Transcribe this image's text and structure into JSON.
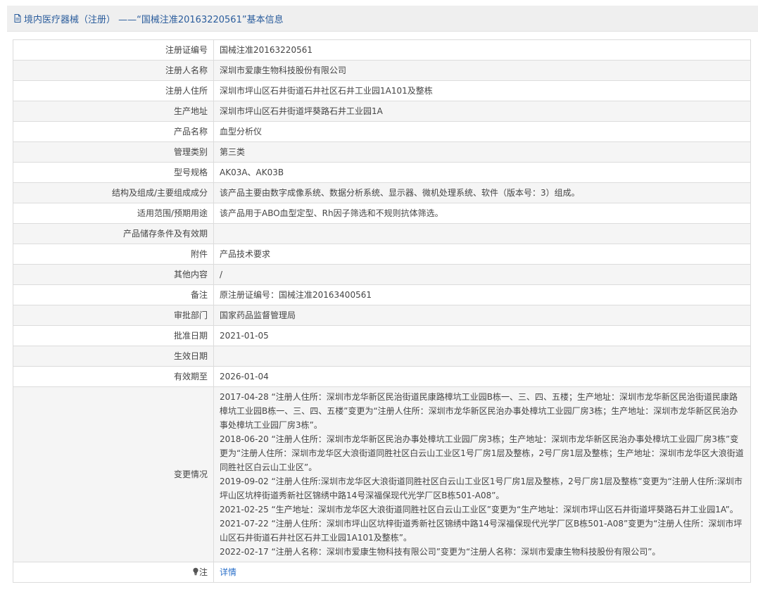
{
  "header": {
    "title": "境内医疗器械（注册） ——“国械注准20163220561”基本信息"
  },
  "fields": [
    {
      "label": "注册证编号",
      "value": "国械注准20163220561"
    },
    {
      "label": "注册人名称",
      "value": "深圳市爱康生物科技股份有限公司"
    },
    {
      "label": "注册人住所",
      "value": "深圳市坪山区石井街道石井社区石井工业园1A101及整栋"
    },
    {
      "label": "生产地址",
      "value": "深圳市坪山区石井街道坪葵路石井工业园1A"
    },
    {
      "label": "产品名称",
      "value": "血型分析仪"
    },
    {
      "label": "管理类别",
      "value": "第三类"
    },
    {
      "label": "型号规格",
      "value": "AK03A、AK03B"
    },
    {
      "label": "结构及组成/主要组成成分",
      "value": "该产品主要由数字成像系统、数据分析系统、显示器、微机处理系统、软件（版本号：3）组成。"
    },
    {
      "label": "适用范围/预期用途",
      "value": "该产品用于ABO血型定型、Rh因子筛选和不规则抗体筛选。"
    },
    {
      "label": "产品储存条件及有效期",
      "value": ""
    },
    {
      "label": "附件",
      "value": "产品技术要求"
    },
    {
      "label": "其他内容",
      "value": "/"
    },
    {
      "label": "备注",
      "value": "原注册证编号：国械注准20163400561"
    },
    {
      "label": "审批部门",
      "value": "国家药品监督管理局"
    },
    {
      "label": "批准日期",
      "value": "2021-01-05"
    },
    {
      "label": "生效日期",
      "value": ""
    },
    {
      "label": "有效期至",
      "value": "2026-01-04"
    }
  ],
  "changes": {
    "label": "变更情况",
    "entries": [
      "2017-04-28 “注册人住所：深圳市龙华新区民治街道民康路樟坑工业园B栋一、三、四、五楼；生产地址：深圳市龙华新区民治街道民康路樟坑工业园B栋一、三、四、五楼”变更为“注册人住所：深圳市龙华新区民治办事处樟坑工业园厂房3栋；生产地址：深圳市龙华新区民治办事处樟坑工业园厂房3栋”。",
      "2018-06-20 “注册人住所：深圳市龙华新区民治办事处樟坑工业园厂房3栋；生产地址：深圳市龙华新区民治办事处樟坑工业园厂房3栋”变更为“注册人住所：深圳市龙华区大浪街道同胜社区白云山工业区1号厂房1层及整栋，2号厂房1层及整栋；生产地址：深圳市龙华区大浪街道同胜社区白云山工业区”。",
      "2019-09-02 “注册人住所:深圳市龙华区大浪街道同胜社区白云山工业区1号厂房1层及整栋，2号厂房1层及整栋”变更为“注册人住所:深圳市坪山区坑梓街道秀新社区锦绣中路14号深福保现代光学厂区B栋501-A08”。",
      "2021-02-25 “生产地址：深圳市龙华区大浪街道同胜社区白云山工业区”变更为“生产地址：深圳市坪山区石井街道坪葵路石井工业园1A”。",
      "2021-07-22 “注册人住所：深圳市坪山区坑梓街道秀新社区锦绣中路14号深福保现代光学厂区B栋501-A08”变更为“注册人住所：深圳市坪山区石井街道石井社区石井工业园1A101及整栋”。",
      "2022-02-17 “注册人名称：深圳市爱康生物科技有限公司”变更为“注册人名称：深圳市爱康生物科技股份有限公司”。"
    ]
  },
  "note": {
    "label": "注",
    "link_text": "详情"
  },
  "colors": {
    "title_text": "#2a5c9c",
    "link": "#2a6fc9",
    "border": "#dcdcdc",
    "row_alt": "#f5f5f5",
    "header_bg": "#efefef"
  },
  "icons": {
    "title": "document-icon",
    "note": "lightbulb-icon"
  }
}
